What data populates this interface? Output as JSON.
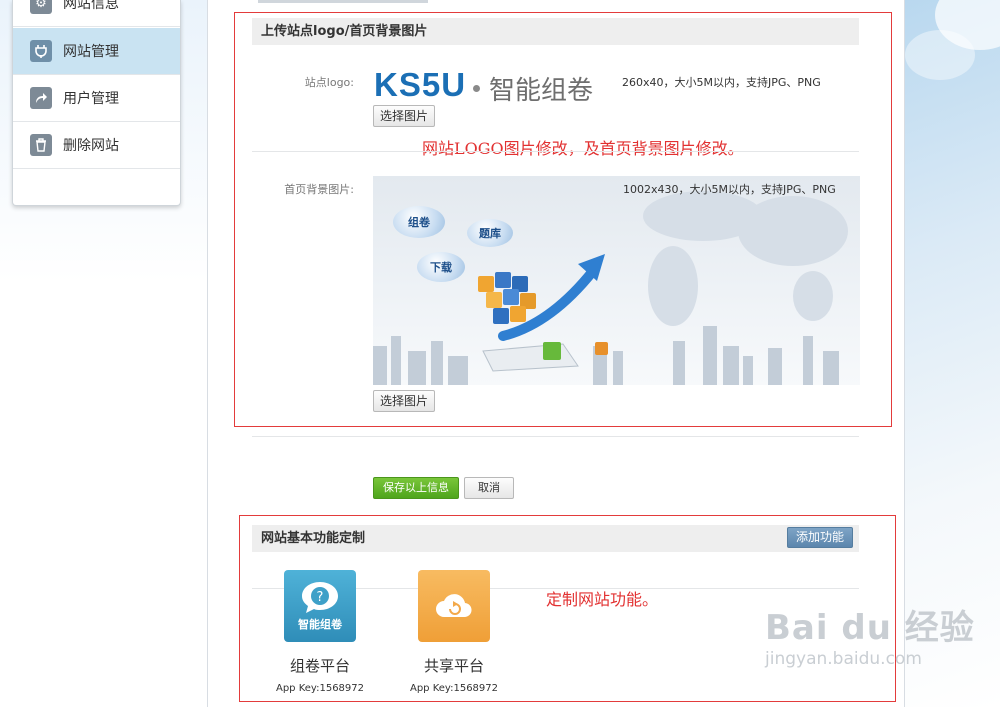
{
  "sidebar": {
    "items": [
      {
        "label": "网站信息",
        "icon": "gear-icon"
      },
      {
        "label": "网站管理",
        "icon": "plug-icon",
        "active": true
      },
      {
        "label": "用户管理",
        "icon": "share-arrow-icon"
      },
      {
        "label": "删除网站",
        "icon": "trash-icon"
      }
    ]
  },
  "upload": {
    "title": "上传站点logo/首页背景图片",
    "logo_label": "站点logo:",
    "logo_brand": "KS5U",
    "logo_text": "智能组卷",
    "logo_hint": "260x40，大小5M以内，支持JPG、PNG",
    "choose_label": "选择图片",
    "bg_label": "首页背景图片:",
    "bg_hint": "1002x430，大小5M以内，支持JPG、PNG",
    "bubbles": [
      "组卷",
      "题库",
      "下载"
    ],
    "annotation": "网站LOGO图片修改，及首页背景图片修改。"
  },
  "actions": {
    "save_label": "保存以上信息",
    "cancel_label": "取消"
  },
  "features": {
    "title": "网站基本功能定制",
    "add_label": "添加功能",
    "annotation": "定制网站功能。",
    "apps": [
      {
        "name": "组卷平台",
        "tile_text": "智能组卷",
        "key": "App Key:1568972",
        "color": "#3ea0c8"
      },
      {
        "name": "共享平台",
        "tile_text": "",
        "key": "App Key:1568972",
        "color": "#f3a94a"
      }
    ]
  },
  "watermark": {
    "brand": "Bai du 经验",
    "url": "jingyan.baidu.com"
  }
}
